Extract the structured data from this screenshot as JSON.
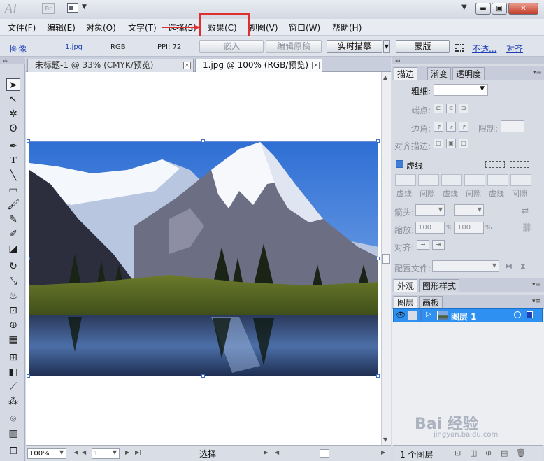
{
  "app": {
    "logo": "Ai",
    "bridge_badge": "Br"
  },
  "menu": [
    "文件(F)",
    "编辑(E)",
    "对象(O)",
    "文字(T)",
    "选择(S)",
    "效果(C)",
    "视图(V)",
    "窗口(W)",
    "帮助(H)"
  ],
  "menu_highlight": "效果(C)",
  "control_bar": {
    "object_type": "图像",
    "filename_link": "1.jpg",
    "color_mode": "RGB",
    "ppi": "PPI: 72",
    "embed_btn": "嵌入",
    "edit_original_btn": "编辑原稿",
    "live_trace_btn": "实时描摹",
    "mask_btn": "蒙版",
    "opacity_link": "不透...",
    "align_link": "对齐"
  },
  "doc_tabs": [
    {
      "label": "未标题-1 @ 33% (CMYK/预览)",
      "active": false
    },
    {
      "label": "1.jpg @ 100% (RGB/预览)",
      "active": true
    }
  ],
  "status_bar": {
    "zoom": "100%",
    "artboard": "1",
    "mode": "选择"
  },
  "stroke_panel": {
    "tabs": [
      "描边",
      "渐变",
      "透明度"
    ],
    "weight_label": "粗细:",
    "cap_label": "端点:",
    "corner_label": "边角:",
    "limit_label": "限制:",
    "align_label": "对齐描边:",
    "dashed_label": "虚线",
    "dash_labels": [
      "虚线",
      "间隙",
      "虚线",
      "间隙",
      "虚线",
      "间隙"
    ],
    "arrow_label": "箭头:",
    "scale_label": "缩放:",
    "scale_values": [
      "100",
      "100"
    ],
    "percent": "%",
    "align2_label": "对齐:",
    "profile_label": "配置文件:"
  },
  "appearance_panel": {
    "tabs": [
      "外观",
      "图形样式"
    ]
  },
  "layers_panel": {
    "tabs": [
      "图层",
      "画板"
    ],
    "layer_name": "图层 1",
    "status": "1 个图层"
  },
  "watermark": {
    "main": "Bai 经验",
    "sub": "jingyan.baidu.com"
  }
}
